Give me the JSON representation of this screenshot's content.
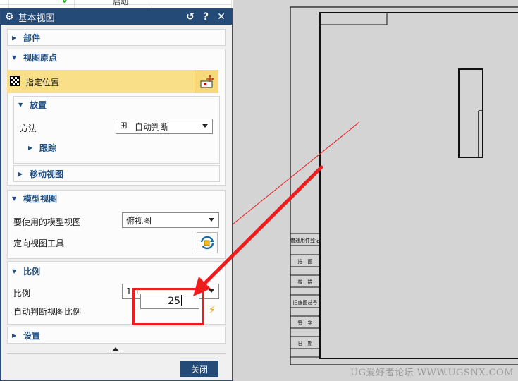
{
  "background": {
    "sheet_cell_text": "启动"
  },
  "dialog": {
    "title": "基本视图",
    "title_buttons": {
      "reset": "↺",
      "help": "?",
      "close": "✕"
    },
    "groups": {
      "part": {
        "label": "部件"
      },
      "view_origin": {
        "label": "视图原点",
        "specify_location": "指定位置",
        "placement": {
          "label": "放置",
          "method_label": "方法",
          "method_value": "自动判断",
          "tracking_label": "跟踪"
        },
        "move_view": {
          "label": "移动视图"
        }
      },
      "model_view": {
        "label": "模型视图",
        "model_view_label": "要使用的模型视图",
        "model_view_value": "俯视图",
        "orient_tool_label": "定向视图工具"
      },
      "scale": {
        "label": "比例",
        "scale_label": "比例",
        "scale_value": "1:1",
        "auto_scale_label": "自动判断视图比例",
        "auto_scale_input": "25"
      },
      "settings": {
        "label": "设置"
      }
    },
    "close_label": "关闭"
  },
  "drawing": {
    "title_block_rows": [
      "借通用件登记",
      "描　图",
      "校　描",
      "旧底图总号",
      "签　字",
      "日　期"
    ],
    "watermark": "UG爱好者论坛 WWW.UGSNX.COM"
  },
  "colors": {
    "titlebar": "#244a77",
    "group_header": "#1f4f82",
    "highlight_row": "#f9df87",
    "annotation_red": "#ee1c1c"
  }
}
